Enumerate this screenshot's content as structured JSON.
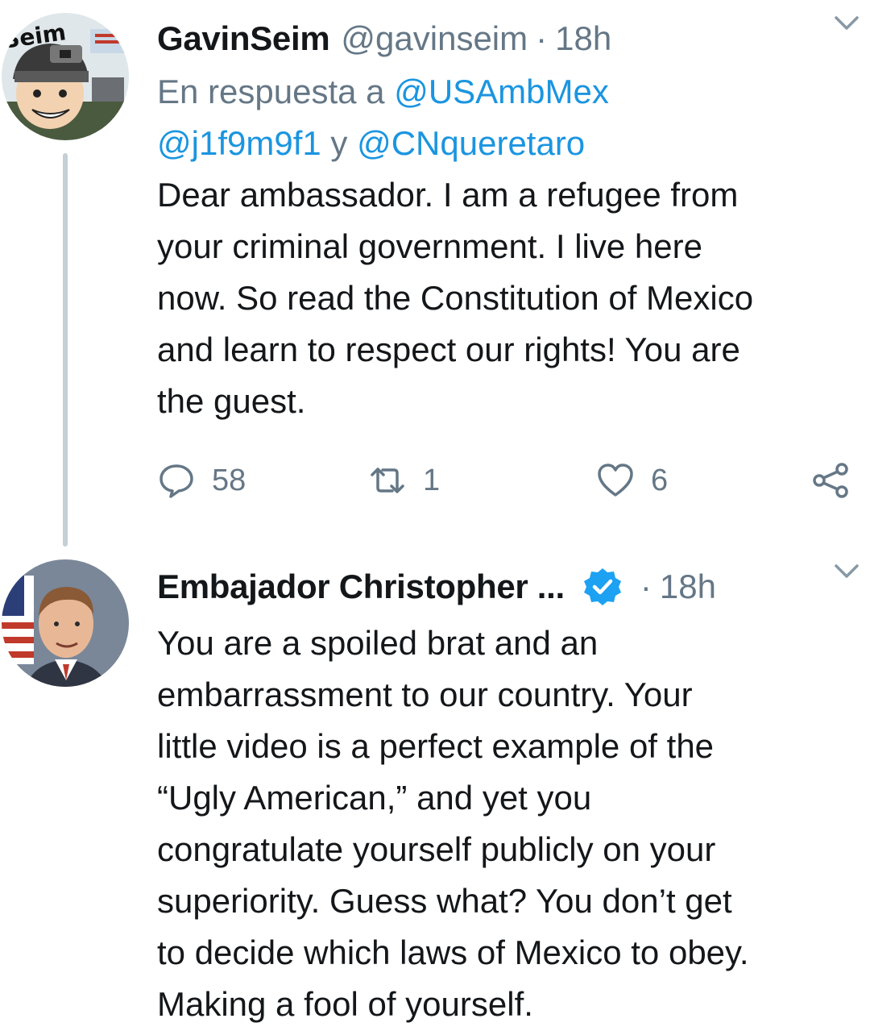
{
  "tweets": [
    {
      "display_name": "GavinSeim",
      "handle": "@gavinseim",
      "separator": "·",
      "time": "18h",
      "avatar_text": "Seim",
      "reply_to": {
        "prefix": "En respuesta a",
        "mention_1": "@USAmbMex",
        "mention_2": "@j1f9m9f1",
        "conjunction": "y",
        "mention_3": "@CNqueretaro"
      },
      "text_lines": [
        "Dear ambassador. I am a refugee from",
        "your criminal government. I live here",
        "now. So read the Constitution of Mexico",
        "and learn to respect our rights! You are",
        "the guest."
      ],
      "actions": {
        "reply_count": "58",
        "retweet_count": "1",
        "like_count": "6"
      },
      "icons": {
        "reply": "reply-icon",
        "retweet": "retweet-icon",
        "like": "heart-icon",
        "share": "share-icon",
        "menu": "chevron-down-icon"
      }
    },
    {
      "display_name": "Embajador Christopher ...",
      "separator": "·",
      "time": "18h",
      "verified": true,
      "text_lines": [
        "You are a spoiled brat and an",
        "embarrassment to our country. Your",
        "little video is a perfect example of the",
        "“Ugly American,” and yet you",
        "congratulate yourself publicly on your",
        "superiority. Guess what? You don’t get",
        "to decide which laws of Mexico to obey.",
        "Making a fool of yourself."
      ],
      "icons": {
        "verified": "verified-badge-icon",
        "menu": "chevron-down-icon"
      }
    }
  ],
  "colors": {
    "link": "#1b95e0",
    "secondary_text": "#657786",
    "primary_text": "#14171a",
    "verified_badge": "#1da1f2",
    "thread_line": "#c4cfd6"
  }
}
